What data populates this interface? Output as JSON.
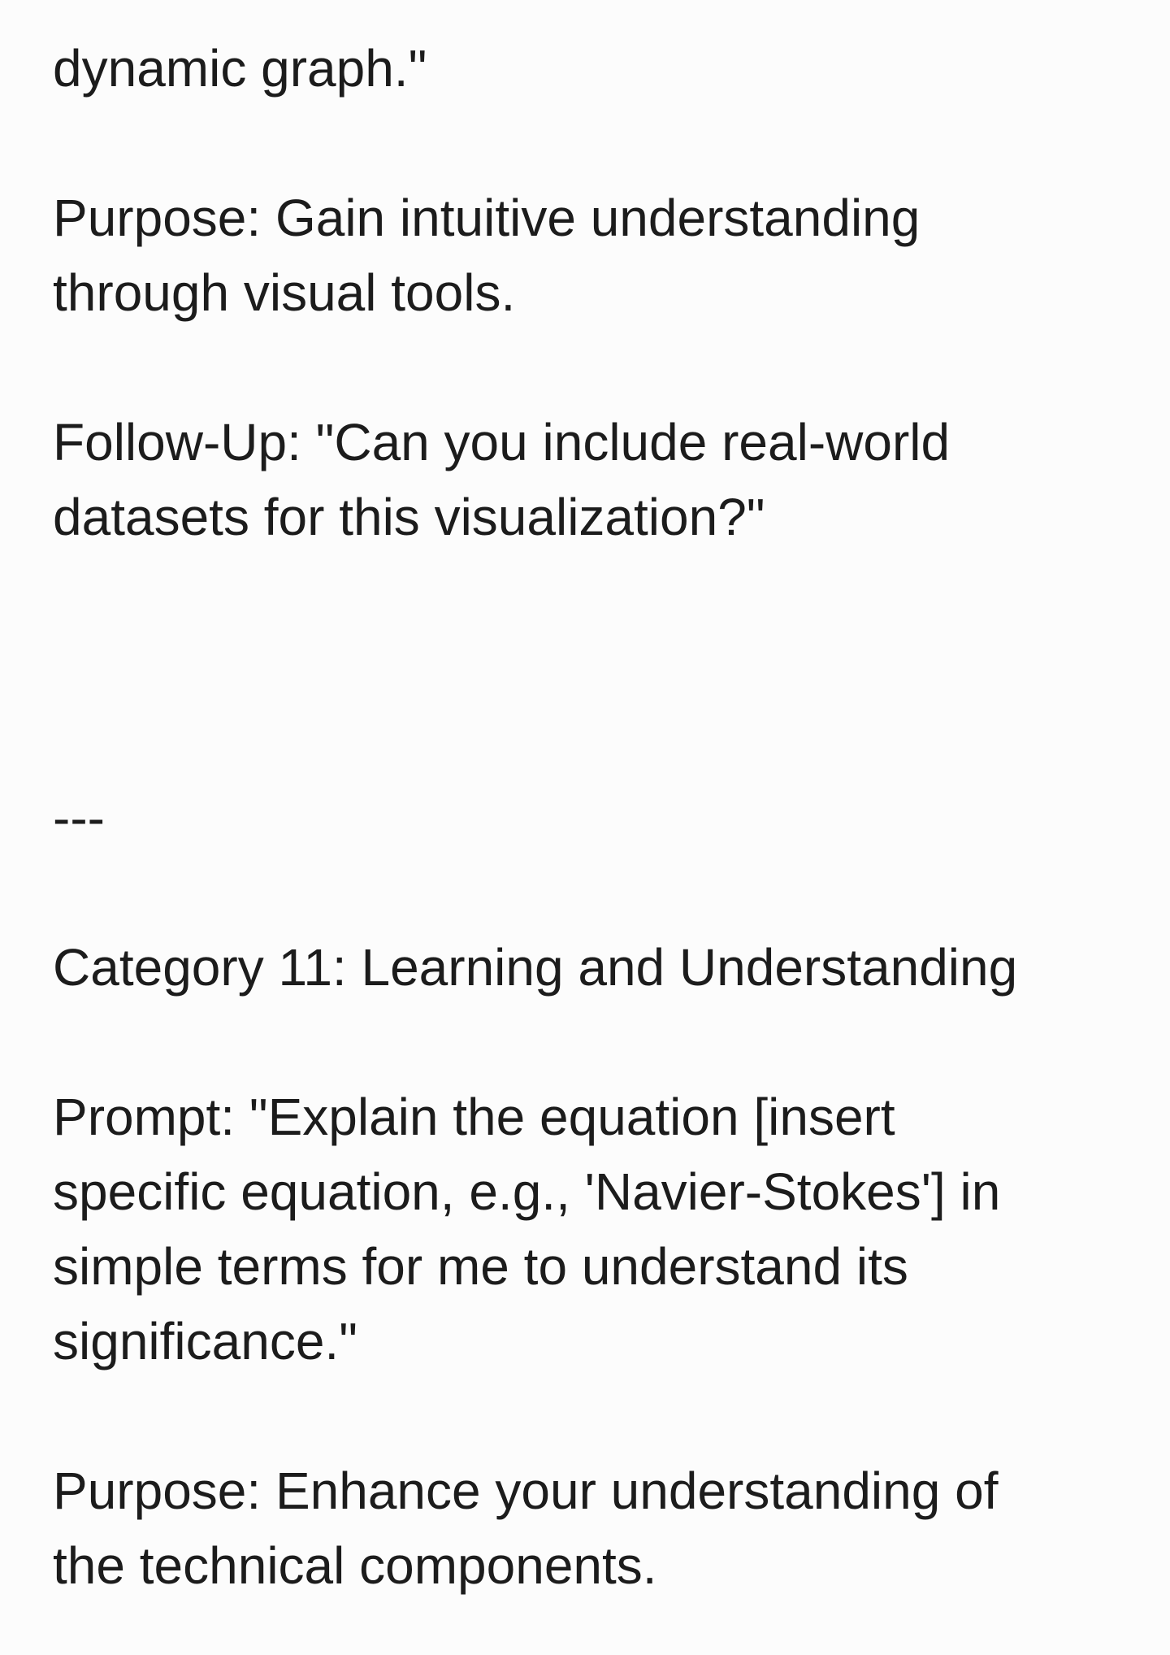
{
  "document": {
    "lines": [
      "dynamic graph.\"",
      "Purpose: Gain intuitive understanding",
      "through visual tools.",
      "Follow-Up: \"Can you include real-world",
      "datasets for this visualization?\"",
      "---",
      "Category 11: Learning and Understanding",
      "Prompt: \"Explain the equation [insert",
      "specific equation, e.g., 'Navier-Stokes'] in",
      "simple terms for me to understand its",
      "significance.\"",
      "Purpose: Enhance your understanding of",
      "the technical components."
    ]
  }
}
